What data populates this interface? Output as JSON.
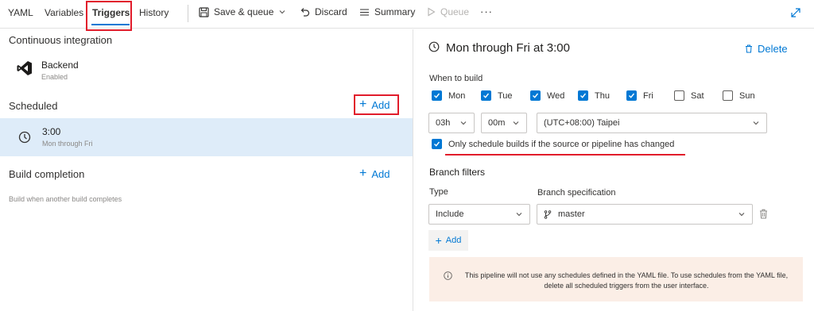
{
  "tabs": [
    {
      "label": "YAML"
    },
    {
      "label": "Variables"
    },
    {
      "label": "Triggers"
    },
    {
      "label": "History"
    }
  ],
  "toolbar": {
    "save_queue": "Save & queue",
    "discard": "Discard",
    "summary": "Summary",
    "queue": "Queue",
    "more": "···"
  },
  "left": {
    "ci_title": "Continuous integration",
    "ci_item_name": "Backend",
    "ci_item_status": "Enabled",
    "scheduled_title": "Scheduled",
    "add_label": "Add",
    "schedule_time": "3:00",
    "schedule_days": "Mon through Fri",
    "build_completion_title": "Build completion",
    "build_completion_add": "Add",
    "build_completion_desc": "Build when another build completes"
  },
  "right": {
    "title": "Mon through Fri at 3:00",
    "delete_label": "Delete",
    "when_to_build": "When to build",
    "days": [
      {
        "label": "Mon",
        "checked": true
      },
      {
        "label": "Tue",
        "checked": true
      },
      {
        "label": "Wed",
        "checked": true
      },
      {
        "label": "Thu",
        "checked": true
      },
      {
        "label": "Fri",
        "checked": true
      },
      {
        "label": "Sat",
        "checked": false
      },
      {
        "label": "Sun",
        "checked": false
      }
    ],
    "hour": "03h",
    "minute": "00m",
    "timezone": "(UTC+08:00) Taipei",
    "only_changed_label": "Only schedule builds if the source or pipeline has changed",
    "only_changed_checked": true,
    "branch_filters_title": "Branch filters",
    "type_label": "Type",
    "branch_spec_label": "Branch specification",
    "type_value": "Include",
    "branch_value": "master",
    "add_filter_label": "Add",
    "info_text": "This pipeline will not use any schedules defined in the YAML file. To use schedules from the YAML file, delete all scheduled triggers from the user interface."
  },
  "colors": {
    "accent": "#0078d4",
    "highlight_row": "#deecf9",
    "annotation_red": "#e11c2b",
    "info_bg": "#fbeee6"
  }
}
